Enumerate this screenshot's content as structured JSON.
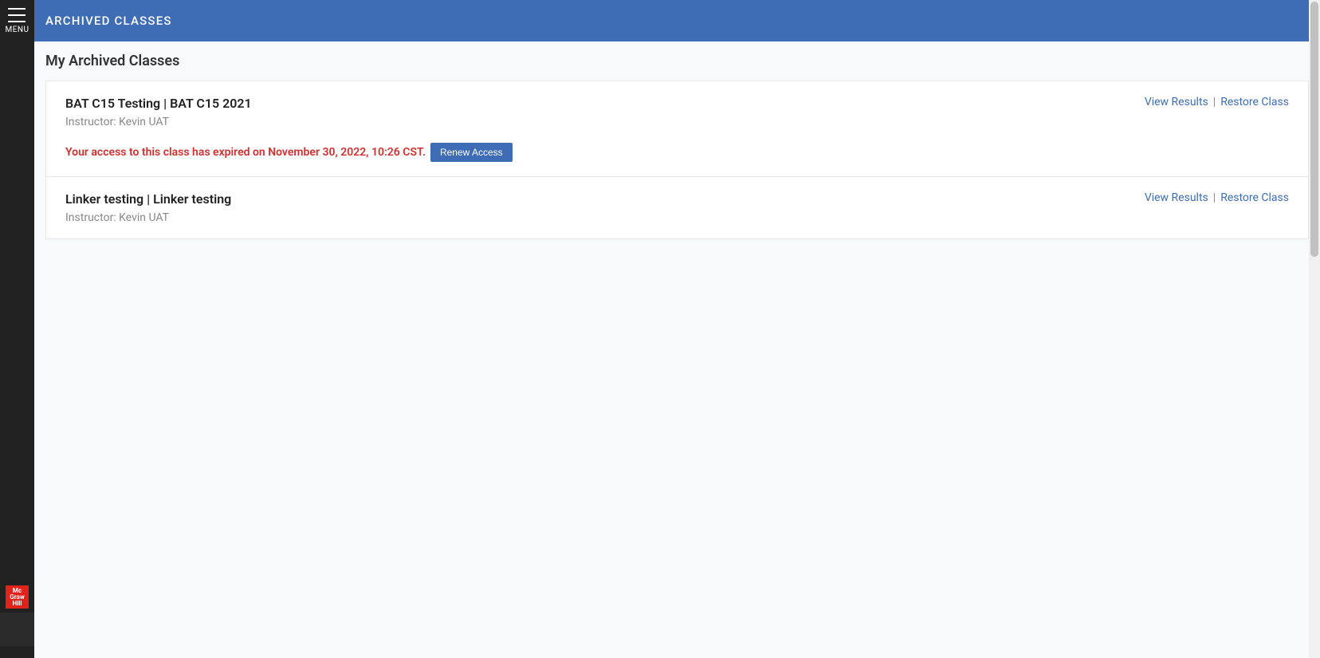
{
  "sidebar": {
    "menu_label": "MENU",
    "logo_lines": [
      "Mc",
      "Graw",
      "Hill"
    ]
  },
  "header": {
    "title": "ARCHIVED CLASSES"
  },
  "section": {
    "title": "My Archived Classes"
  },
  "classes": [
    {
      "title": "BAT C15 Testing | BAT C15 2021",
      "instructor": "Instructor: Kevin UAT",
      "expired_text": "Your access to this class has expired on November 30, 2022, 10:26 CST.",
      "renew_label": "Renew Access",
      "view_results": "View Results",
      "restore_class": "Restore Class",
      "show_expired": true
    },
    {
      "title": "Linker testing | Linker testing",
      "instructor": "Instructor: Kevin UAT",
      "view_results": "View Results",
      "restore_class": "Restore Class",
      "show_expired": false
    }
  ],
  "action_separator": "|"
}
